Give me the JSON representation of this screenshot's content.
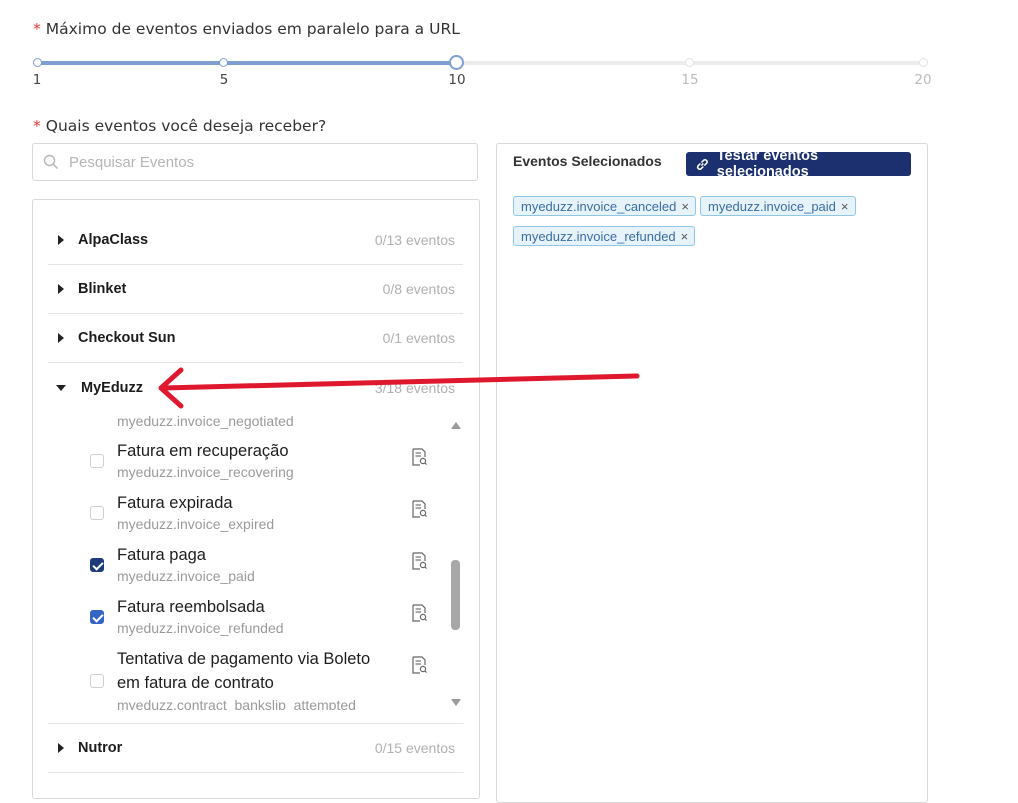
{
  "concurrency": {
    "required_mark": "*",
    "label": "Máximo de eventos enviados em paralelo para a URL",
    "ticks": [
      "1",
      "5",
      "10",
      "15",
      "20"
    ],
    "value": 10,
    "min": 1,
    "max": 20
  },
  "events": {
    "required_mark": "*",
    "label": "Quais eventos você deseja receber?",
    "search_placeholder": "Pesquisar Eventos",
    "groups": [
      {
        "name": "AlpaClass",
        "count": "0/13 eventos"
      },
      {
        "name": "Blinket",
        "count": "0/8 eventos"
      },
      {
        "name": "Checkout Sun",
        "count": "0/1 eventos"
      },
      {
        "name": "MyEduzz",
        "count": "3/18 eventos"
      },
      {
        "name": "Nutror",
        "count": "0/15 eventos"
      }
    ],
    "myeduzz_items": [
      {
        "title": "",
        "slug": "myeduzz.invoice_negotiated",
        "checked": false
      },
      {
        "title": "Fatura em recuperação",
        "slug": "myeduzz.invoice_recovering",
        "checked": false
      },
      {
        "title": "Fatura expirada",
        "slug": "myeduzz.invoice_expired",
        "checked": false
      },
      {
        "title": "Fatura paga",
        "slug": "myeduzz.invoice_paid",
        "checked": true
      },
      {
        "title": "Fatura reembolsada",
        "slug": "myeduzz.invoice_refunded",
        "checked": true
      },
      {
        "title_line1": "Tentativa de pagamento via Boleto",
        "title_line2": "em fatura de contrato",
        "slug": "myeduzz.contract_bankslip_attempted",
        "checked": false
      }
    ]
  },
  "selected": {
    "title": "Eventos Selecionados",
    "test_button": "Testar eventos selecionados",
    "tags": [
      "myeduzz.invoice_canceled",
      "myeduzz.invoice_paid",
      "myeduzz.invoice_refunded"
    ],
    "remove_glyph": "×"
  },
  "colors": {
    "accent": "#1c2f6e",
    "annotation_arrow": "#e0182d",
    "slider": "#7f9fd3"
  }
}
